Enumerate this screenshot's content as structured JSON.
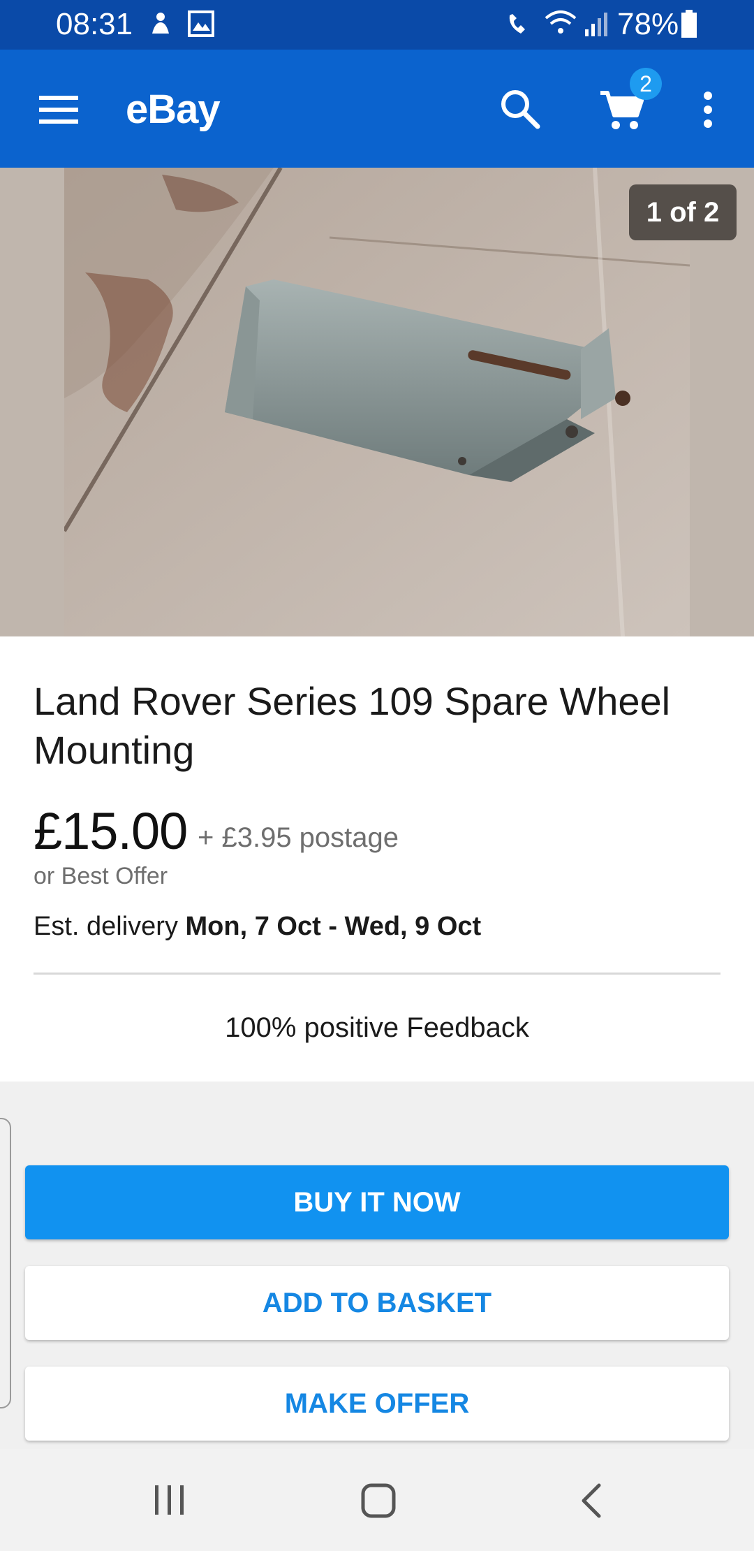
{
  "status_bar": {
    "time": "08:31",
    "battery": "78%",
    "icons": [
      "notification-icon",
      "gallery-icon",
      "wifi-call-icon",
      "wifi-icon",
      "signal-icon",
      "battery-icon"
    ]
  },
  "app_bar": {
    "title": "eBay",
    "cart_count": "2",
    "icons": [
      "menu-icon",
      "search-icon",
      "cart-icon",
      "more-vert-icon"
    ],
    "color": "#0b63ce"
  },
  "gallery": {
    "counter": "1 of 2"
  },
  "listing": {
    "title": "Land Rover Series 109 Spare Wheel Mounting",
    "price": "£15.00",
    "postage": "+ £3.95 postage",
    "best_offer": "or Best Offer",
    "delivery_label": "Est. delivery",
    "delivery_dates": "Mon, 7 Oct - Wed, 9 Oct",
    "feedback": "100% positive Feedback"
  },
  "actions": {
    "buy_now": "BUY IT NOW",
    "add_to_basket": "ADD TO BASKET",
    "make_offer": "MAKE OFFER",
    "primary_color": "#1192f0"
  },
  "nav_bar": {
    "icons": [
      "recent-apps-icon",
      "home-icon",
      "back-icon"
    ]
  }
}
